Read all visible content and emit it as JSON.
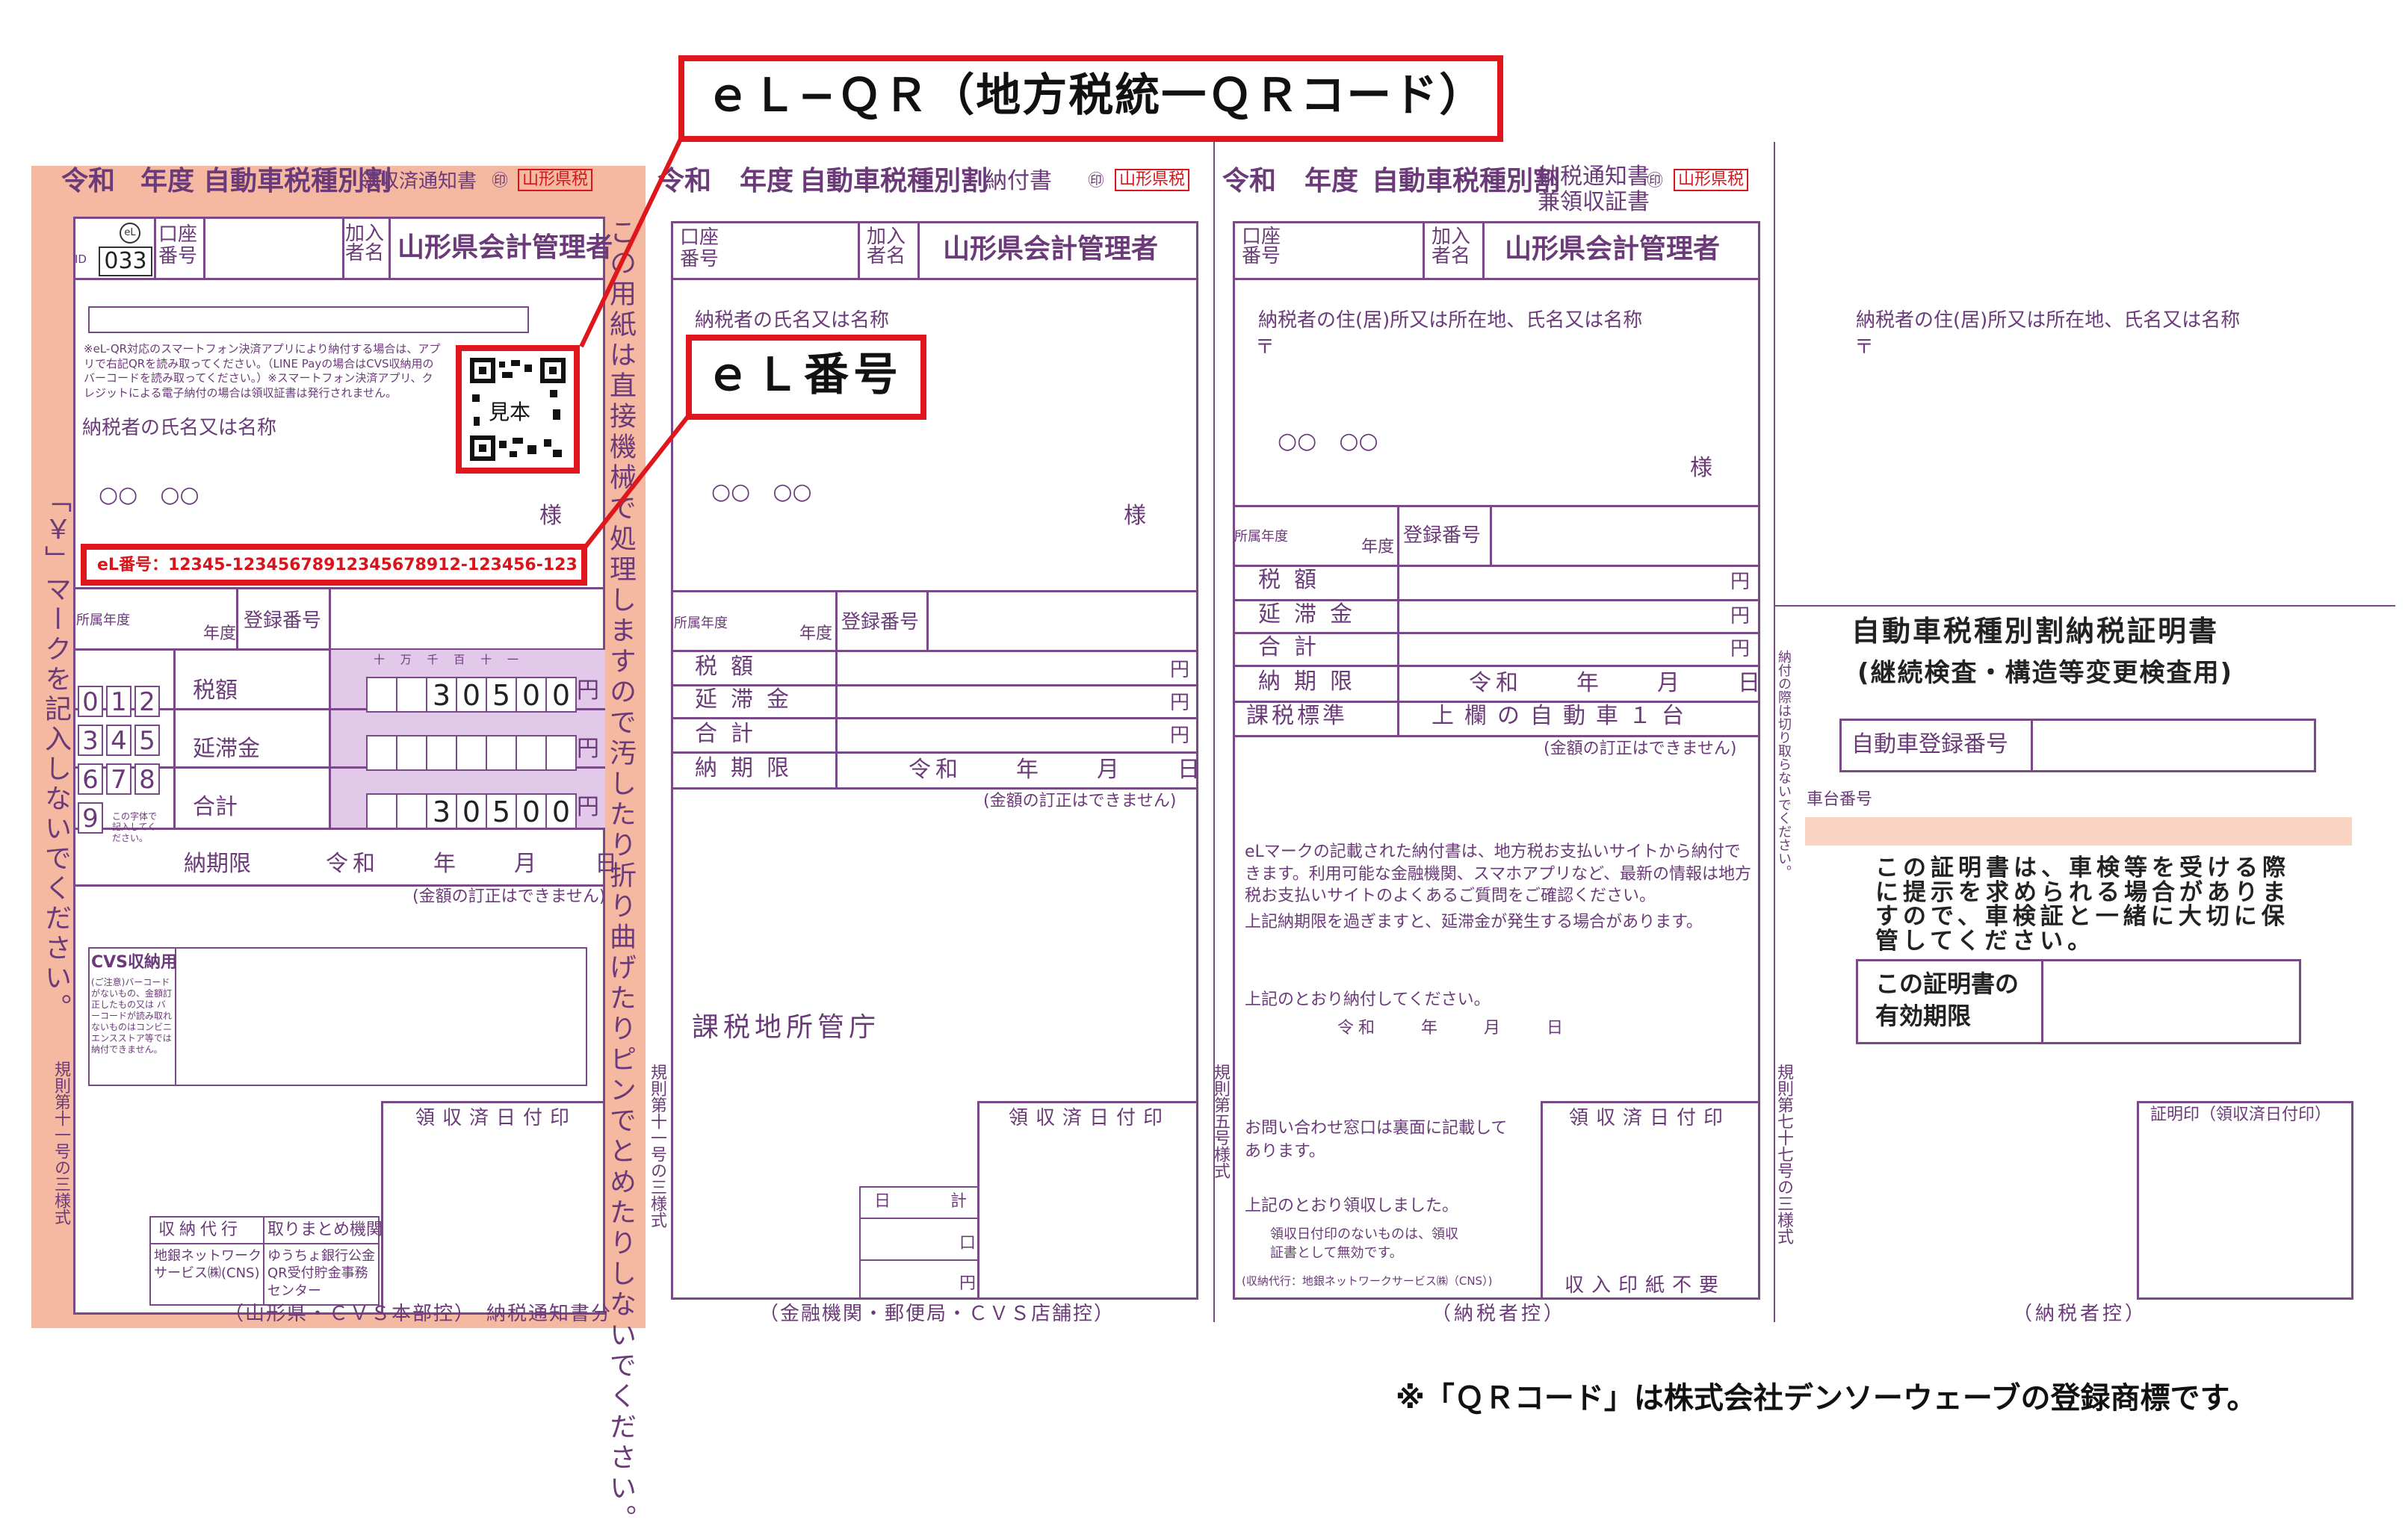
{
  "colors": {
    "accent_red": "#e0161d",
    "form_purple": "#6b3a79",
    "salmon_panel": "#f5b8a0",
    "salmon_strip": "#fbd3c2"
  },
  "callouts": {
    "elqr": "ｅＬ−ＱＲ（地方税統一ＱＲコード）",
    "elnum": "ｅＬ番号"
  },
  "common": {
    "reiwa": "令和",
    "nendo_label": "年度",
    "tax_kind": "自動車税種別割",
    "stamp": "山形県税",
    "koza_no": "口座番号",
    "kanyu": "加入者名",
    "kanyu_name": "山形県会計管理者",
    "payer_name_label": "納税者の氏名又は名称",
    "payer_addr_label": "納税者の住(居)所又は所在地、氏名又は名称",
    "postal": "〒",
    "payer_name": "○○　○○",
    "sama": "様",
    "shozoku": "所属年度",
    "nendo": "年度",
    "toroku": "登録番号",
    "zeigaku": "税額",
    "entai": "延滞金",
    "gokei": "合計",
    "nouki": "納期限",
    "date_row": "令和　　年　　月　　日",
    "en": "円",
    "no_correction": "(金額の訂正はできません)",
    "ryoshu_stamp": "領収済日付印"
  },
  "part1": {
    "doc": "領収済通知書",
    "id": "ID",
    "id_no": "033",
    "el_mark": "eL",
    "qr_note": "※eL-QR対応のスマートフォン決済アプリにより納付する場合は、アプリで右記QRを読み取ってください。（LINE Payの場合はCVS収納用のバーコードを読み取ってください。）※スマートフォン決済アプリ、クレジットによる電子納付の場合は領収証書は発行されません。",
    "qr_label": "見本",
    "el_number": "eL番号：12345-12345678912345678912-123456-123",
    "amount_digits": [
      "3",
      "0",
      "5",
      "0",
      "0"
    ],
    "digit_header": "十 万 千 百 十 一",
    "left_strip": "「￥」マークを記入しないでください。",
    "left_digits": [
      "0",
      "1",
      "2",
      "3",
      "4",
      "5",
      "6",
      "7",
      "8",
      "9"
    ],
    "left_digit_note": "この字体で記入してください。",
    "cvs_title": "CVS収納用",
    "cvs_note": "(ご注意)バーコードがないもの、金額訂正したもの又は バーコードが読み取れないものはコンビニエンスストア等では納付できません。",
    "agent": "収納代行",
    "agent_name": "地銀ネットワークサービス㈱(CNS)",
    "agg": "取りまとめ機関",
    "agg_name": "ゆうちょ銀行公金QR受付貯金事務センター",
    "kisoku": "規則第十一号の三様式",
    "footer": "（山形県・ＣＶＳ本部控）　納税通知書分",
    "vertical_note": "この用紙は直接機械で処理しますので汚したり折り曲げたりピンでとめたりしないでください。"
  },
  "part2": {
    "doc": "納付書",
    "kazei": "課税地所管庁",
    "hi": "日　　計",
    "kuchi": "口",
    "en_unit": "円",
    "kisoku": "規則第十一号の三様式",
    "footer": "（金融機関・郵便局・ＣＶＳ店舗控）"
  },
  "part3": {
    "doc1": "納税通知書",
    "doc2": "兼領収証書",
    "kazei_kijun": "課税標準",
    "kazei_kijun_val": "上欄の自動車１台",
    "el_note": "eLマークの記載された納付書は、地方税お支払いサイトから納付できます。利用可能な金融機関、スマホアプリなど、最新の情報は地方税お支払いサイトのよくあるご質問をご確認ください。",
    "late_note": "上記納期限を過ぎますと、延滞金が発生する場合があります。",
    "pay_please": "上記のとおり納付してください。",
    "reiwa_date": "令和　　年　　月　　日",
    "inquiry": "お問い合わせ窓口は裏面に記載してあります。",
    "received": "上記のとおり領収しました。",
    "invalid": "領収日付印のないものは、領収証書として無効です。",
    "agent_note": "(収納代行：地銀ネットワークサービス㈱（CNS）)",
    "stamp_free": "収入印紙不要",
    "kisoku": "規則第五号様式",
    "footer": "（納税者控）"
  },
  "part4": {
    "cut_note": "納付の際は切り取らないでください。",
    "title": "自動車税種別割納税証明書",
    "subtitle": "(継続検査・構造等変更検査用)",
    "car_reg": "自動車登録番号",
    "chassis": "車台番号",
    "notice": "この証明書は、車検等を受ける際に提示を求められる場合がありますので、車検証と一緒に大切に保管してください。",
    "validity": "この証明書の有効期限",
    "cert_stamp": "証明印（領収済日付印）",
    "kisoku": "規則第七十七号の三様式",
    "footer": "（納税者控）"
  },
  "trademark": "※「ＱＲコード」は株式会社デンソーウェーブの登録商標です。"
}
